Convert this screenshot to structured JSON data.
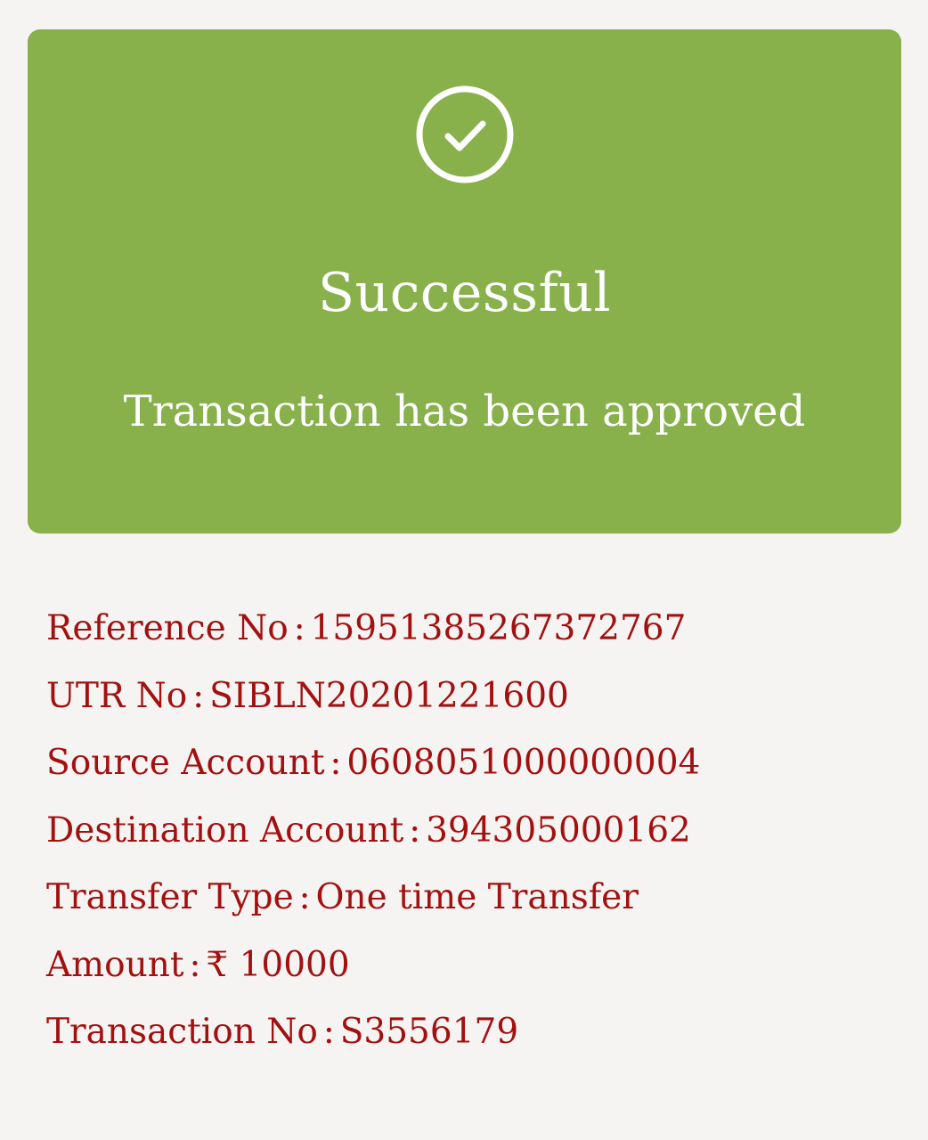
{
  "status": {
    "icon": "check-circle-icon",
    "title": "Successful",
    "message": "Transaction has been approved",
    "color": "#88b04b"
  },
  "details": [
    {
      "label": "Reference No",
      "value": "15951385267372767"
    },
    {
      "label": "UTR No",
      "value": "SIBLN20201221600"
    },
    {
      "label": "Source Account",
      "value": "0608051000000004"
    },
    {
      "label": "Destination Account",
      "value": "394305000162"
    },
    {
      "label": "Transfer Type",
      "value": "One time Transfer"
    },
    {
      "label": "Amount",
      "value": "₹ 10000"
    },
    {
      "label": "Transaction No",
      "value": "S3556179"
    }
  ],
  "separator": ":",
  "text_color": "#a31010"
}
